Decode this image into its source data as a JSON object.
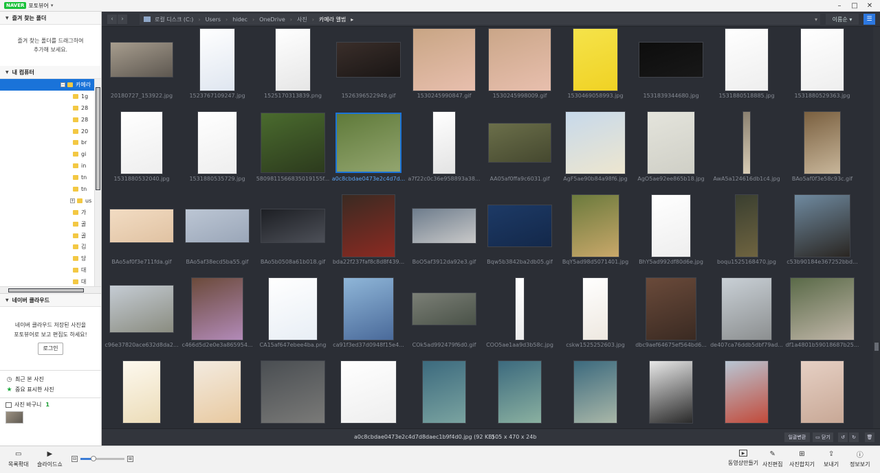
{
  "app": {
    "logo": "NAVER",
    "name": "포토뷰어",
    "menu_caret": "▾"
  },
  "window_controls": [
    "–",
    "□",
    "✕"
  ],
  "left": {
    "favorites": {
      "title": "즐겨 찾는 폴더",
      "hint_line1": "즐겨 찾는 폴더를 드래그하여",
      "hint_line2": "추가해 보세요."
    },
    "computer": {
      "title": "내 컴퓨터",
      "tree": [
        {
          "label": "카메라",
          "selected": true,
          "indent": 1,
          "expander": "minus"
        },
        {
          "label": "1g",
          "indent": 2
        },
        {
          "label": "28",
          "indent": 2
        },
        {
          "label": "28",
          "indent": 2
        },
        {
          "label": "20",
          "indent": 2
        },
        {
          "label": "br",
          "indent": 2
        },
        {
          "label": "gi",
          "indent": 2
        },
        {
          "label": "in",
          "indent": 2
        },
        {
          "label": "tn",
          "indent": 2
        },
        {
          "label": "tn",
          "indent": 2
        },
        {
          "label": "us",
          "indent": 2,
          "expander": "plus"
        },
        {
          "label": "가",
          "indent": 2
        },
        {
          "label": "골",
          "indent": 2
        },
        {
          "label": "골",
          "indent": 2
        },
        {
          "label": "김",
          "indent": 2
        },
        {
          "label": "당",
          "indent": 2
        },
        {
          "label": "대",
          "indent": 2
        },
        {
          "label": "대",
          "indent": 2
        },
        {
          "label": "대",
          "indent": 2
        }
      ]
    },
    "cloud": {
      "title": "네이버 클라우드",
      "hint_line1": "네이버 클라우드 저장된 사진을",
      "hint_line2": "포토뷰어로 보고 편집도 하세요!",
      "login": "로그인"
    },
    "quick": [
      {
        "label": "최근 본 사진",
        "icon": "clock-icon",
        "glyph": "◷"
      },
      {
        "label": "중요 표시한 사진",
        "icon": "star-icon",
        "glyph": "★"
      }
    ],
    "basket": {
      "label": "사진 바구니",
      "count": "1"
    }
  },
  "nav": {
    "back": "‹",
    "forward": "›",
    "path": [
      "로컬 디스크 (C:)",
      "Users",
      "hidec",
      "OneDrive",
      "사진",
      "카메라 앨범"
    ],
    "sort_label": "이름순",
    "sort_caret": "▾",
    "path_caret": "▾",
    "path_tail": "▸",
    "view_glyph": "☰"
  },
  "thumbnails": [
    {
      "name": "20180727_153922.jpg",
      "colors": [
        "#a79d8e",
        "#5d5750"
      ],
      "w": 92,
      "h": 52
    },
    {
      "name": "1523767109247.jpg",
      "colors": [
        "#ffffff",
        "#dfe6f0"
      ],
      "w": 52,
      "h": 92
    },
    {
      "name": "1525170313839.png",
      "colors": [
        "#ffffff",
        "#e6e6e6"
      ],
      "w": 52,
      "h": 92
    },
    {
      "name": "1526396522949.gif",
      "colors": [
        "#3a2e2a",
        "#1a1615"
      ],
      "w": 94,
      "h": 52
    },
    {
      "name": "1530245990847.gif",
      "colors": [
        "#c8a584",
        "#e8bfae"
      ],
      "w": 92,
      "h": 92
    },
    {
      "name": "1530245998009.gif",
      "colors": [
        "#caa688",
        "#e8bfae"
      ],
      "w": 92,
      "h": 92
    },
    {
      "name": "1530469058993.jpg",
      "colors": [
        "#f5e34a",
        "#f0d224"
      ],
      "w": 66,
      "h": 92
    },
    {
      "name": "1531839344680.jpg",
      "colors": [
        "#0d0d0d",
        "#181818"
      ],
      "w": 94,
      "h": 52
    },
    {
      "name": "1531880518885.jpg",
      "colors": [
        "#ffffff",
        "#eeeeee"
      ],
      "w": 64,
      "h": 92
    },
    {
      "name": "1531880529363.jpg",
      "colors": [
        "#ffffff",
        "#eeeeee"
      ],
      "w": 64,
      "h": 92
    },
    {
      "name": "1531880532040.jpg",
      "colors": [
        "#ffffff",
        "#eeeeee"
      ],
      "w": 62,
      "h": 92
    },
    {
      "name": "1531880535729.jpg",
      "colors": [
        "#ffffff",
        "#eeeeee"
      ],
      "w": 58,
      "h": 92
    },
    {
      "name": "5809811566835019155f...",
      "colors": [
        "#4a6b2e",
        "#2c3a1d"
      ],
      "w": 94,
      "h": 88
    },
    {
      "name": "a0c8cbdae0473e2c4d7d...",
      "colors": [
        "#5f7a3a",
        "#93a56f"
      ],
      "w": 96,
      "h": 88,
      "selected": true
    },
    {
      "name": "a7f22c0c36e958893a38...",
      "colors": [
        "#ffffff",
        "#e3e3e3"
      ],
      "w": 34,
      "h": 92
    },
    {
      "name": "AA05af0ffa9c6031.gif",
      "colors": [
        "#6b6f4a",
        "#45482f"
      ],
      "w": 92,
      "h": 58
    },
    {
      "name": "AgF5ae90b84a98f6.jpg",
      "colors": [
        "#c7d9eb",
        "#ede6cf"
      ],
      "w": 88,
      "h": 92
    },
    {
      "name": "AgO5ae92ee865b18.jpg",
      "colors": [
        "#e4e4dc",
        "#cfcfc6"
      ],
      "w": 70,
      "h": 92
    },
    {
      "name": "AwA5a124616db1c4.jpg",
      "colors": [
        "#8a8070",
        "#d9cdb6"
      ],
      "w": 12,
      "h": 92
    },
    {
      "name": "BAo5af0f3e58c93c.gif",
      "colors": [
        "#7a6040",
        "#c8b69a"
      ],
      "w": 54,
      "h": 92
    },
    {
      "name": "BAo5af0f3e711fda.gif",
      "colors": [
        "#f2dcc3",
        "#e0c2a2"
      ],
      "w": 94,
      "h": 50
    },
    {
      "name": "BAo5af38ecd5ba55.gif",
      "colors": [
        "#bcc6d4",
        "#9aa6b8"
      ],
      "w": 94,
      "h": 50
    },
    {
      "name": "BAo5b0508a61b018.gif",
      "colors": [
        "#1d1f24",
        "#4d5058"
      ],
      "w": 94,
      "h": 50
    },
    {
      "name": "bda22f237faf8c8d8f439...",
      "colors": [
        "#3a2a22",
        "#8c2a22"
      ],
      "w": 78,
      "h": 92
    },
    {
      "name": "BoO5af3912da92e3.gif",
      "colors": [
        "#6d7c8c",
        "#c9c9c9"
      ],
      "w": 94,
      "h": 52
    },
    {
      "name": "Bqw5b3842ba2db05.gif",
      "colors": [
        "#1d3a66",
        "#13284a"
      ],
      "w": 94,
      "h": 62
    },
    {
      "name": "BqY5ad98d5071401.jpg",
      "colors": [
        "#6b7a3d",
        "#c9a86a"
      ],
      "w": 70,
      "h": 92
    },
    {
      "name": "BhY5ad992df80d6e.jpg",
      "colors": [
        "#ffffff",
        "#eeeeee"
      ],
      "w": 58,
      "h": 92
    },
    {
      "name": "boqu1525168470.jpg",
      "colors": [
        "#3a3f30",
        "#6f6440"
      ],
      "w": 34,
      "h": 92
    },
    {
      "name": "c53b90184e367252bbd...",
      "colors": [
        "#6f8aa0",
        "#2a2622"
      ],
      "w": 82,
      "h": 92
    },
    {
      "name": "c96e37820ace632d8da2...",
      "colors": [
        "#c5ccd4",
        "#8a8c80"
      ],
      "w": 94,
      "h": 70
    },
    {
      "name": "c466d5d2e0e3a865954...",
      "colors": [
        "#6b4a3a",
        "#b28ab8"
      ],
      "w": 76,
      "h": 92
    },
    {
      "name": "CA15af647ebee4ba.png",
      "colors": [
        "#ffffff",
        "#e8eef5"
      ],
      "w": 72,
      "h": 92
    },
    {
      "name": "ca91f3ed37d0948f15e4...",
      "colors": [
        "#8fb6d8",
        "#4a6a9a"
      ],
      "w": 74,
      "h": 92
    },
    {
      "name": "COk5ad992479f6d0.gif",
      "colors": [
        "#7b7f76",
        "#4a5248"
      ],
      "w": 94,
      "h": 48
    },
    {
      "name": "COO5ae1aa9d3b58c.jpg",
      "colors": [
        "#ffffff",
        "#ececec"
      ],
      "w": 14,
      "h": 92
    },
    {
      "name": "cskw1525252603.jpg",
      "colors": [
        "#ffffff",
        "#eee8e0"
      ],
      "w": 38,
      "h": 92
    },
    {
      "name": "dbc9aef64675ef564bd6...",
      "colors": [
        "#6a4a3a",
        "#3a2a22"
      ],
      "w": 74,
      "h": 92
    },
    {
      "name": "de407ca76ddb5dbf79ad...",
      "colors": [
        "#c9d0d6",
        "#8c8f90"
      ],
      "w": 74,
      "h": 92
    },
    {
      "name": "df1a4801b59018687b25...",
      "colors": [
        "#5a6a48",
        "#c0b6a8"
      ],
      "w": 94,
      "h": 92
    },
    {
      "name": "img_r5_1",
      "colors": [
        "#fdf9ef",
        "#ecdcb8"
      ],
      "w": 56,
      "h": 92
    },
    {
      "name": "img_r5_2",
      "colors": [
        "#f3ebe0",
        "#e8c9a0"
      ],
      "w": 70,
      "h": 92
    },
    {
      "name": "img_r5_3",
      "colors": [
        "#4a4e52",
        "#7a7a78"
      ],
      "w": 94,
      "h": 92
    },
    {
      "name": "img_r5_4",
      "colors": [
        "#ffffff",
        "#eeeeee"
      ],
      "w": 82,
      "h": 92
    },
    {
      "name": "img_r5_5",
      "colors": [
        "#3c6a7e",
        "#7aa3a0"
      ],
      "w": 64,
      "h": 92
    },
    {
      "name": "img_r5_6",
      "colors": [
        "#3c6a7e",
        "#8ab0a0"
      ],
      "w": 64,
      "h": 92
    },
    {
      "name": "img_r5_7",
      "colors": [
        "#3c6a7e",
        "#a9b7a8"
      ],
      "w": 64,
      "h": 92
    },
    {
      "name": "img_r5_8",
      "colors": [
        "#e8e8e8",
        "#2a2a2a"
      ],
      "w": 64,
      "h": 92
    },
    {
      "name": "img_r5_9",
      "colors": [
        "#b8c6d4",
        "#c24a3a"
      ],
      "w": 64,
      "h": 92
    },
    {
      "name": "img_r5_10",
      "colors": [
        "#e6d0c4",
        "#c8a896"
      ],
      "w": 64,
      "h": 92
    }
  ],
  "status": {
    "filename": "a0c8cbdae0473e2c4d7d8daec1b9f4d0.jpg (92 KB)",
    "dimensions": "505 x 470 x 24b",
    "convert_label": "일괄변환",
    "close_label": "닫기"
  },
  "bottom": {
    "left_buttons": [
      {
        "label": "목록확대",
        "icon": "list-expand-icon",
        "glyph": "▭"
      },
      {
        "label": "슬라이드쇼",
        "icon": "slideshow-play-icon",
        "glyph": "▶"
      }
    ],
    "zoom": {
      "fraction": 0.3
    },
    "right_buttons": [
      {
        "label": "동영상만들기",
        "icon": "video-make-icon",
        "glyph": "🎞"
      },
      {
        "label": "사진편집",
        "icon": "edit-wand-icon",
        "glyph": "✎"
      },
      {
        "label": "사진합치기",
        "icon": "merge-grid-icon",
        "glyph": "⊞"
      },
      {
        "label": "보내기",
        "icon": "send-icon",
        "glyph": "⇪"
      },
      {
        "label": "정보보기",
        "icon": "info-icon",
        "glyph": "ⓘ"
      }
    ]
  }
}
